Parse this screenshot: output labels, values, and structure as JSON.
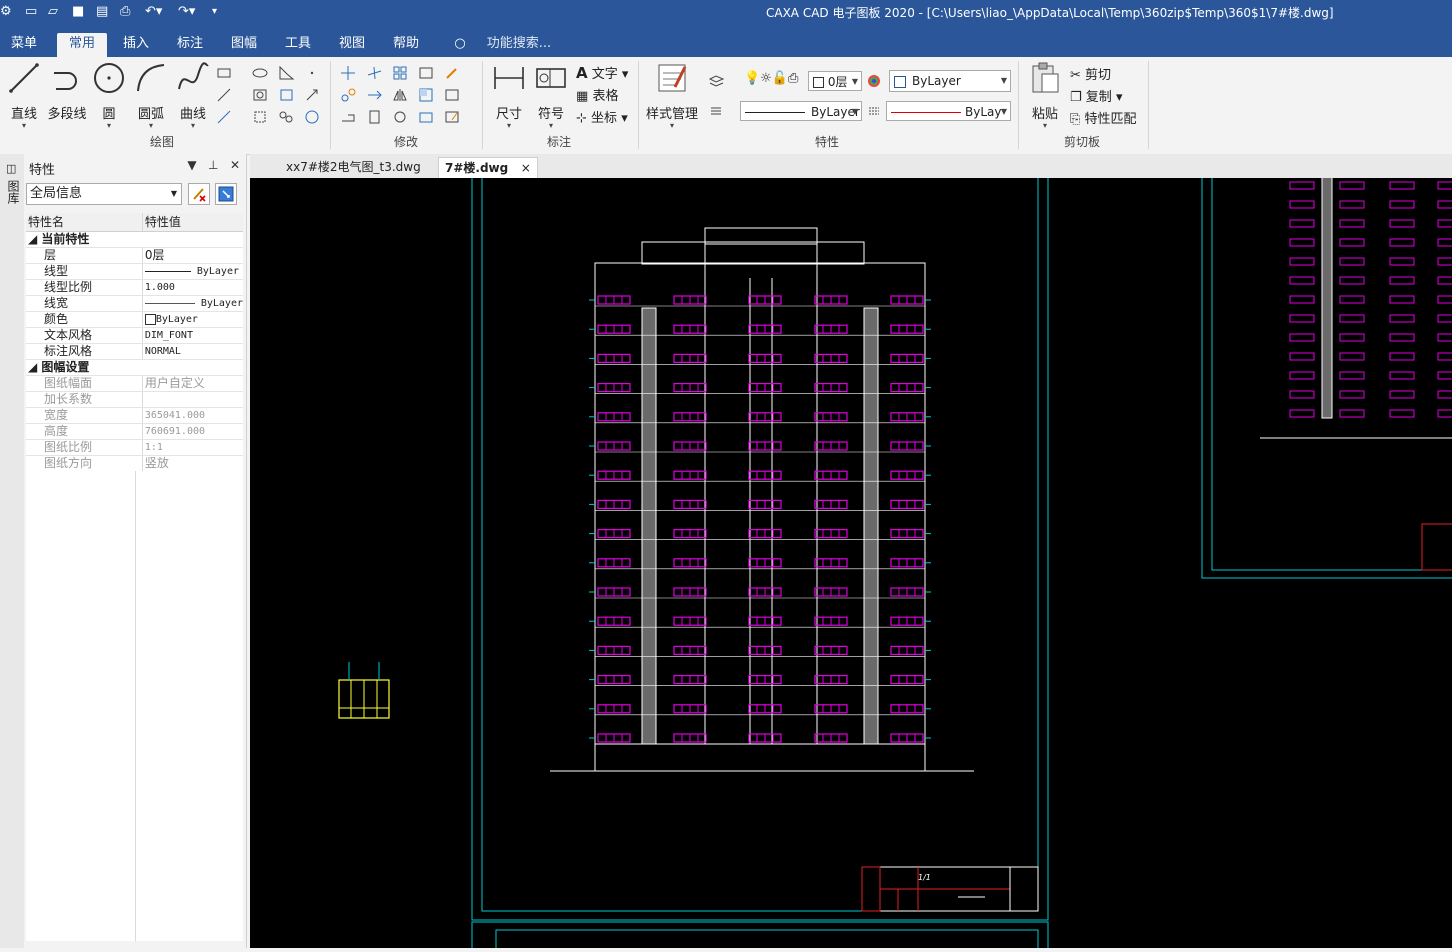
{
  "window": {
    "title": "CAXA CAD 电子图板 2020 - [C:\\Users\\liao_\\AppData\\Local\\Temp\\360zip$Temp\\360$1\\7#楼.dwg]"
  },
  "menu": {
    "tabs": [
      "菜单",
      "常用",
      "插入",
      "标注",
      "图幅",
      "工具",
      "视图",
      "帮助"
    ],
    "active": "常用",
    "search_placeholder": "功能搜索..."
  },
  "ribbon": {
    "draw": {
      "label": "绘图",
      "line": "直线",
      "polyline": "多段线",
      "circle": "圆",
      "arc": "圆弧",
      "curve": "曲线"
    },
    "modify": {
      "label": "修改"
    },
    "annotate": {
      "label": "标注",
      "dimension": "尺寸",
      "symbol": "符号",
      "text": "文字",
      "table": "表格",
      "coord": "坐标"
    },
    "properties": {
      "label": "特性",
      "style_mgr": "样式管理",
      "layer_value": "0层",
      "color_value": "ByLayer",
      "linetype_value": "ByLayer",
      "linewidth_value": "ByLay"
    },
    "clipboard": {
      "label": "剪切板",
      "paste": "粘贴",
      "cut": "剪切",
      "copy": "复制",
      "match": "特性匹配"
    }
  },
  "side_strip": {
    "label": "图库"
  },
  "panel": {
    "title": "特性",
    "scope": "全局信息",
    "columns": [
      "特性名",
      "特性值"
    ],
    "current": {
      "category": "当前特性",
      "rows": [
        {
          "name": "层",
          "value": "0层"
        },
        {
          "name": "线型",
          "value": "ByLayer"
        },
        {
          "name": "线型比例",
          "value": "1.000"
        },
        {
          "name": "线宽",
          "value": "ByLayer"
        },
        {
          "name": "颜色",
          "value": "ByLayer"
        },
        {
          "name": "文本风格",
          "value": "DIM_FONT"
        },
        {
          "name": "标注风格",
          "value": "NORMAL"
        }
      ]
    },
    "sheet": {
      "category": "图幅设置",
      "rows": [
        {
          "name": "图纸幅面",
          "value": "用户自定义"
        },
        {
          "name": "加长系数",
          "value": ""
        },
        {
          "name": "宽度",
          "value": "365041.000"
        },
        {
          "name": "高度",
          "value": "760691.000"
        },
        {
          "name": "图纸比例",
          "value": "1:1"
        },
        {
          "name": "图纸方向",
          "value": "竖放"
        }
      ]
    }
  },
  "doc_tabs": [
    {
      "name": "xx7#楼2电气图_t3.dwg",
      "active": false
    },
    {
      "name": "7#楼.dwg",
      "active": true
    }
  ],
  "doc_close": "×",
  "drawing": {
    "title_block_mark": "1/1"
  },
  "colors": {
    "accent": "#2b579a",
    "canvas": "#000000",
    "frame": "#00c8d0",
    "window_hatch": "#e000e0",
    "line": "#ffffff",
    "block": "#ffff33",
    "titleblock": "#e02020"
  }
}
